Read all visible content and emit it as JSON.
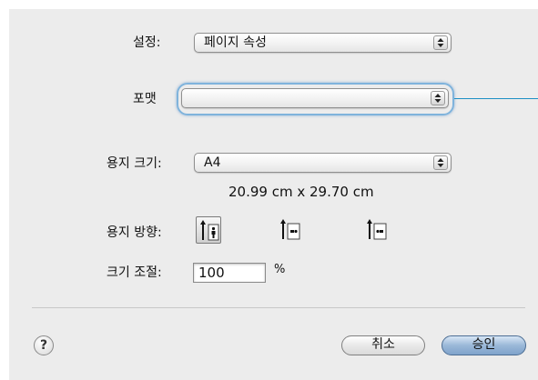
{
  "settings": {
    "label": "설정:",
    "value": "페이지 속성"
  },
  "format": {
    "label": "포맷",
    "value": ""
  },
  "paper_size": {
    "label": "용지 크기:",
    "value": "A4",
    "dimensions": "20.99 cm x 29.70 cm"
  },
  "orientation": {
    "label": "용지 방향:",
    "options": [
      {
        "name": "portrait",
        "selected": true
      },
      {
        "name": "landscape-left",
        "selected": false
      },
      {
        "name": "landscape-right",
        "selected": false
      }
    ]
  },
  "scale": {
    "label": "크기 조절:",
    "value": "100",
    "unit": "%"
  },
  "buttons": {
    "help": "?",
    "cancel": "취소",
    "ok": "승인"
  },
  "colors": {
    "focus_ring": "#7fb3dc",
    "callout_line": "#1c8fc4",
    "default_button": "#9ab8d8"
  }
}
